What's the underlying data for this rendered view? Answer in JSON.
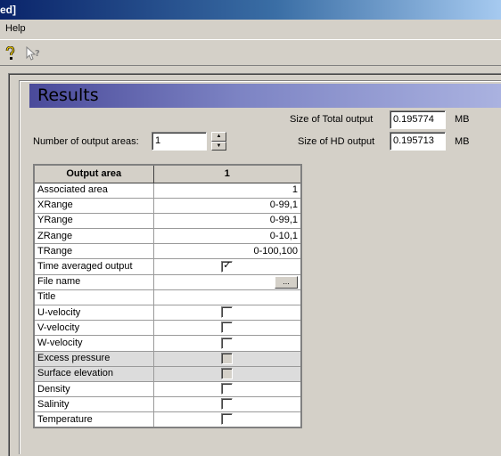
{
  "window": {
    "title": "ed]"
  },
  "menu": {
    "items": [
      {
        "label": "Help"
      }
    ]
  },
  "toolbar": {
    "icons": [
      "help-question-icon",
      "context-help-icon"
    ]
  },
  "results": {
    "heading": "Results",
    "number_of_output_areas_label": "Number of output areas:",
    "number_of_output_areas_value": "1",
    "total_output_label": "Size of Total output",
    "total_output_value": "0.195774",
    "total_output_unit": "MB",
    "hd_output_label": "Size of HD output",
    "hd_output_value": "0.195713",
    "hd_output_unit": "MB"
  },
  "grid": {
    "header": {
      "corner": "Output area",
      "column": "1"
    },
    "rows": [
      {
        "label": "Associated area",
        "type": "text",
        "value": "1"
      },
      {
        "label": "XRange",
        "type": "text",
        "value": "0-99,1"
      },
      {
        "label": "YRange",
        "type": "text",
        "value": "0-99,1"
      },
      {
        "label": "ZRange",
        "type": "text",
        "value": "0-10,1"
      },
      {
        "label": "TRange",
        "type": "text",
        "value": "0-100,100"
      },
      {
        "label": "Time averaged output",
        "type": "checkbox",
        "checked": true
      },
      {
        "label": "File name",
        "type": "file",
        "value": "",
        "button": "..."
      },
      {
        "label": "Title",
        "type": "text",
        "value": ""
      },
      {
        "label": "U-velocity",
        "type": "checkbox",
        "checked": false
      },
      {
        "label": "V-velocity",
        "type": "checkbox",
        "checked": false
      },
      {
        "label": "W-velocity",
        "type": "checkbox",
        "checked": false
      },
      {
        "label": "Excess pressure",
        "type": "checkbox",
        "checked": false,
        "disabled": true
      },
      {
        "label": "Surface elevation",
        "type": "checkbox",
        "checked": false,
        "disabled": true
      },
      {
        "label": "Density",
        "type": "checkbox",
        "checked": false
      },
      {
        "label": "Salinity",
        "type": "checkbox",
        "checked": false
      },
      {
        "label": "Temperature",
        "type": "checkbox",
        "checked": false
      }
    ]
  }
}
